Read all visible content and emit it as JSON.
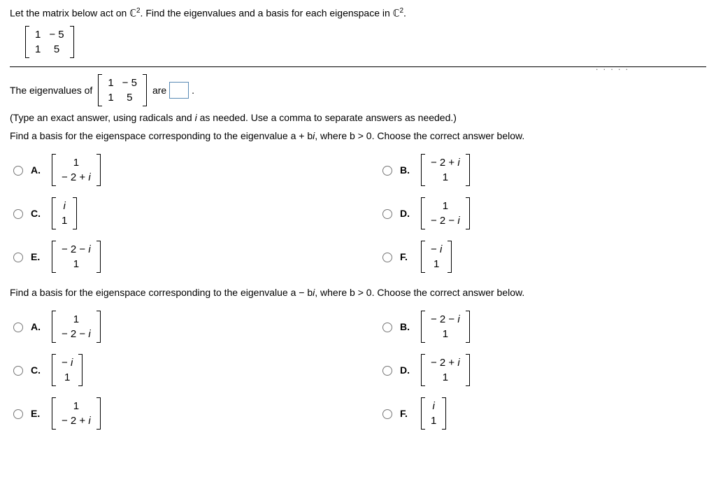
{
  "intro_a": "Let the matrix below act on ",
  "cset": "ℂ",
  "sq": "2",
  "intro_b": ". Find the eigenvalues and a basis for each eigenspace in ",
  "intro_c": ".",
  "matrix": {
    "r1c1": "1",
    "r1c2": "− 5",
    "r2c1": "1",
    "r2c2": "5"
  },
  "eig_a": "The eigenvalues of ",
  "eig_b": " are ",
  "eig_c": ".",
  "hint": "(Type an exact answer, using radicals and i as needed. Use a comma to separate answers as needed.)",
  "q1": "Find a basis for the eigenspace corresponding to the eigenvalue a + bi, where b > 0. Choose the correct answer below.",
  "q2": "Find a basis for the eigenspace corresponding to the eigenvalue a − bi, where b > 0. Choose the correct answer below.",
  "labels": {
    "A": "A.",
    "B": "B.",
    "C": "C.",
    "D": "D.",
    "E": "E.",
    "F": "F."
  },
  "q1opts": {
    "A": {
      "t": "1",
      "b": "− 2 + i"
    },
    "B": {
      "t": "− 2 + i",
      "b": "1"
    },
    "C": {
      "t": "i",
      "b": "1"
    },
    "D": {
      "t": "1",
      "b": "− 2 − i"
    },
    "E": {
      "t": "− 2 − i",
      "b": "1"
    },
    "F": {
      "t": "− i",
      "b": "1"
    }
  },
  "q2opts": {
    "A": {
      "t": "1",
      "b": "− 2 − i"
    },
    "B": {
      "t": "− 2 − i",
      "b": "1"
    },
    "C": {
      "t": "− i",
      "b": "1"
    },
    "D": {
      "t": "− 2 + i",
      "b": "1"
    },
    "E": {
      "t": "1",
      "b": "− 2 + i"
    },
    "F": {
      "t": "i",
      "b": "1"
    }
  },
  "dots": ". . . . ."
}
